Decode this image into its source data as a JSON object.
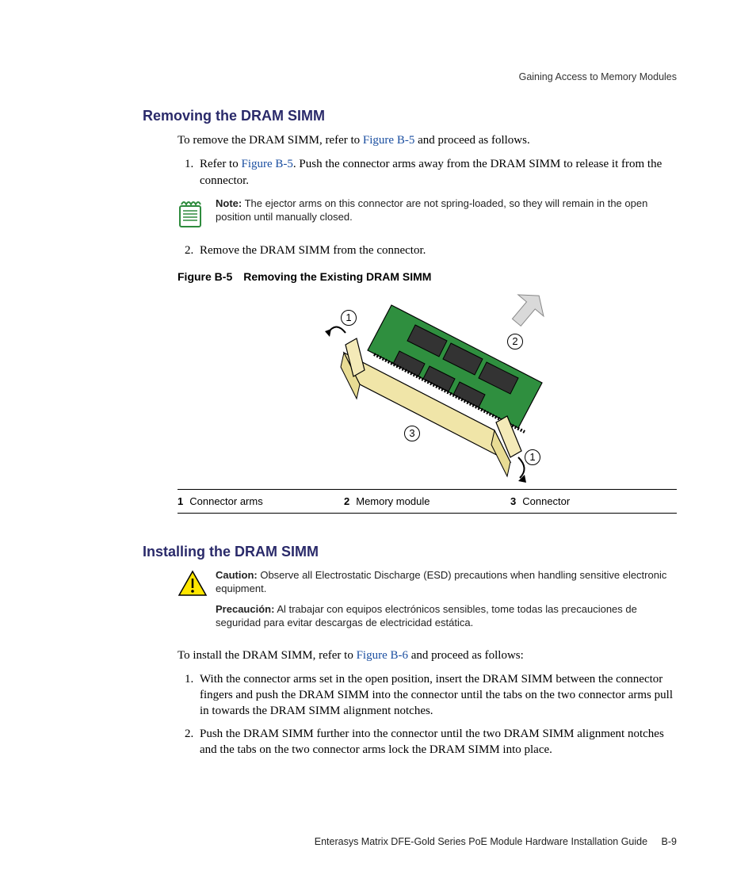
{
  "running_head": "Gaining Access to Memory Modules",
  "section1": {
    "title": "Removing the DRAM SIMM",
    "intro_pre": "To remove the DRAM SIMM, refer to ",
    "intro_link": "Figure B-5",
    "intro_post": " and proceed as follows.",
    "step1_pre": "Refer to ",
    "step1_link": "Figure B-5",
    "step1_post": ". Push the connector arms away from the DRAM SIMM to release it from the connector.",
    "note_label": "Note:",
    "note_text": " The ejector arms on this connector are not spring-loaded, so they will remain in the open position until manually closed.",
    "step2": "Remove the DRAM SIMM from the connector."
  },
  "figure": {
    "caption": "Figure B-5 Removing the Existing DRAM SIMM",
    "callouts": {
      "c1": "1",
      "c2": "2",
      "c3": "3",
      "c1b": "1"
    },
    "legend": [
      {
        "num": "1",
        "text": "Connector arms"
      },
      {
        "num": "2",
        "text": "Memory module"
      },
      {
        "num": "3",
        "text": "Connector"
      }
    ]
  },
  "section2": {
    "title": "Installing the DRAM SIMM",
    "caution_label": "Caution:",
    "caution_en": " Observe all Electrostatic Discharge (ESD) precautions when handling sensitive electronic equipment.",
    "caution_es_label": "Precaución:",
    "caution_es": " Al trabajar con equipos electrónicos sensibles, tome todas las precauciones de seguridad para evitar descargas  de electricidad estática.",
    "intro_pre": "To install the DRAM SIMM, refer to ",
    "intro_link": "Figure B-6",
    "intro_post": " and proceed as follows:",
    "step1": "With the connector arms set in the open position, insert the DRAM SIMM between the connector fingers and push the DRAM SIMM into the connector until the tabs on the two connector arms pull in towards the DRAM SIMM alignment notches.",
    "step2": "Push the DRAM SIMM further into the connector until the two DRAM SIMM alignment notches and the tabs on the two connector arms lock the DRAM SIMM into place."
  },
  "footer": {
    "text": "Enterasys Matrix DFE-Gold Series PoE Module Hardware Installation Guide",
    "page": "B-9"
  }
}
